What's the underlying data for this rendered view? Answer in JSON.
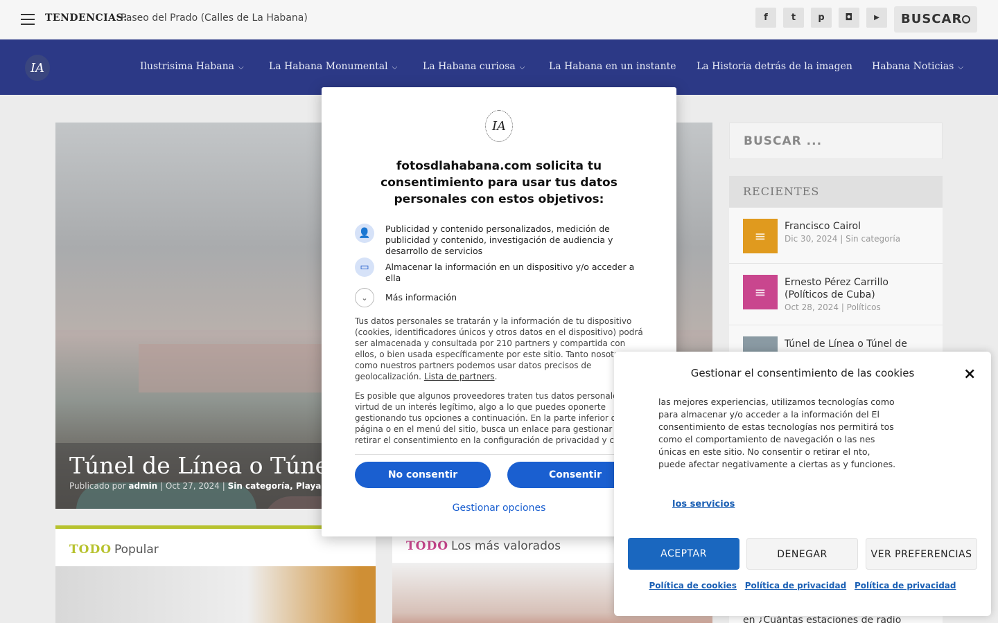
{
  "topbar": {
    "trending_label": "TENDENCIAS:",
    "trending_link": "Paseo del Prado (Calles de La Habana)",
    "social": [
      {
        "icon": "facebook-icon",
        "glyph": "f"
      },
      {
        "icon": "twitter-icon",
        "glyph": "t"
      },
      {
        "icon": "pinterest-icon",
        "glyph": "p"
      },
      {
        "icon": "instagram-icon",
        "glyph": "◘"
      },
      {
        "icon": "youtube-icon",
        "glyph": "▶"
      }
    ],
    "search_label": "BUSCAR"
  },
  "nav": {
    "logo": "IA",
    "items": [
      {
        "label": "Ilustrisima Habana",
        "has_dropdown": true
      },
      {
        "label": "La Habana Monumental",
        "has_dropdown": true
      },
      {
        "label": "La Habana curiosa",
        "has_dropdown": true
      },
      {
        "label": "La Habana en un instante",
        "has_dropdown": false
      },
      {
        "label": "La Historia detrás de la imagen",
        "has_dropdown": false
      },
      {
        "label": "Habana Noticias",
        "has_dropdown": true
      }
    ]
  },
  "featured": {
    "title": "Túnel de Línea o Túnel de",
    "meta_prefix": "Publicado por",
    "author": "admin",
    "date": "Oct 27, 2024",
    "categories": "Sin categoría, Playa, Plaza"
  },
  "sidebar": {
    "search_placeholder": "BUSCAR ...",
    "recent_heading": "RECIENTES",
    "recent": [
      {
        "title": "Francisco Cairol",
        "date": "Dic 30, 2024",
        "category": "Sin categoría",
        "thumb_color": "#e09a1e"
      },
      {
        "title": "Ernesto Pérez Carrillo (Políticos de Cuba)",
        "date": "Oct 28, 2024",
        "category": "Políticos",
        "thumb_color": "#c9468e"
      },
      {
        "title": "Túnel de Línea o Túnel de",
        "date": "",
        "category": "",
        "thumb_color": "#8a9aa3"
      }
    ],
    "bottom_text": "en ¿Cuántas estaciones de radio"
  },
  "cards": [
    {
      "todo": "TODO",
      "label": "Popular",
      "accent": "#b7c22e"
    },
    {
      "todo": "TODO",
      "label": "Los más valorados",
      "accent": "#c9468e"
    }
  ],
  "consent_modal": {
    "logo": "IA",
    "title": "fotosdlahabana.com solicita tu consentimiento para usar tus datos personales con estos objetivos:",
    "purposes": [
      {
        "icon": "person-icon",
        "text": "Publicidad y contenido personalizados, medición de publicidad y contenido, investigación de audiencia y desarrollo de servicios"
      },
      {
        "icon": "device-icon",
        "text": "Almacenar la información en un dispositivo y/o acceder a ella"
      }
    ],
    "more_info": "Más información",
    "paragraph1": "Tus datos personales se tratarán y la información de tu dispositivo (cookies, identificadores únicos y otros datos en el dispositivo) podrá ser almacenada y consultada por 210 partners y compartida con ellos, o bien usada específicamente por este sitio. Tanto nosotros como nuestros partners podemos usar datos precisos de geolocalización.",
    "partners_link": "Lista de partners",
    "paragraph2": "Es posible que algunos proveedores traten tus datos personales en virtud de un interés legítimo, algo a lo que puedes oponerte gestionando tus opciones a continuación. En la parte inferior de esta página o en el menú del sitio, busca un enlace para gestionar o retirar el consentimiento en la configuración de privacidad y cookies.",
    "deny_button": "No consentir",
    "accept_button": "Consentir",
    "manage_link": "Gestionar opciones"
  },
  "cookie_banner": {
    "title": "Gestionar el consentimiento de las cookies",
    "close": "×",
    "text": "las mejores experiencias, utilizamos tecnologías como para almacenar y/o acceder a la información del El consentimiento de estas tecnologías nos permitirá tos como el comportamiento de navegación o las nes únicas en este sitio. No consentir o retirar el nto, puede afectar negativamente a ciertas as y funciones.",
    "services_link": "los servicios",
    "accept": "ACEPTAR",
    "deny": "DENEGAR",
    "preferences": "VER PREFERENCIAS",
    "links": [
      "Política de cookies",
      "Política de privacidad",
      "Política de privacidad"
    ]
  }
}
